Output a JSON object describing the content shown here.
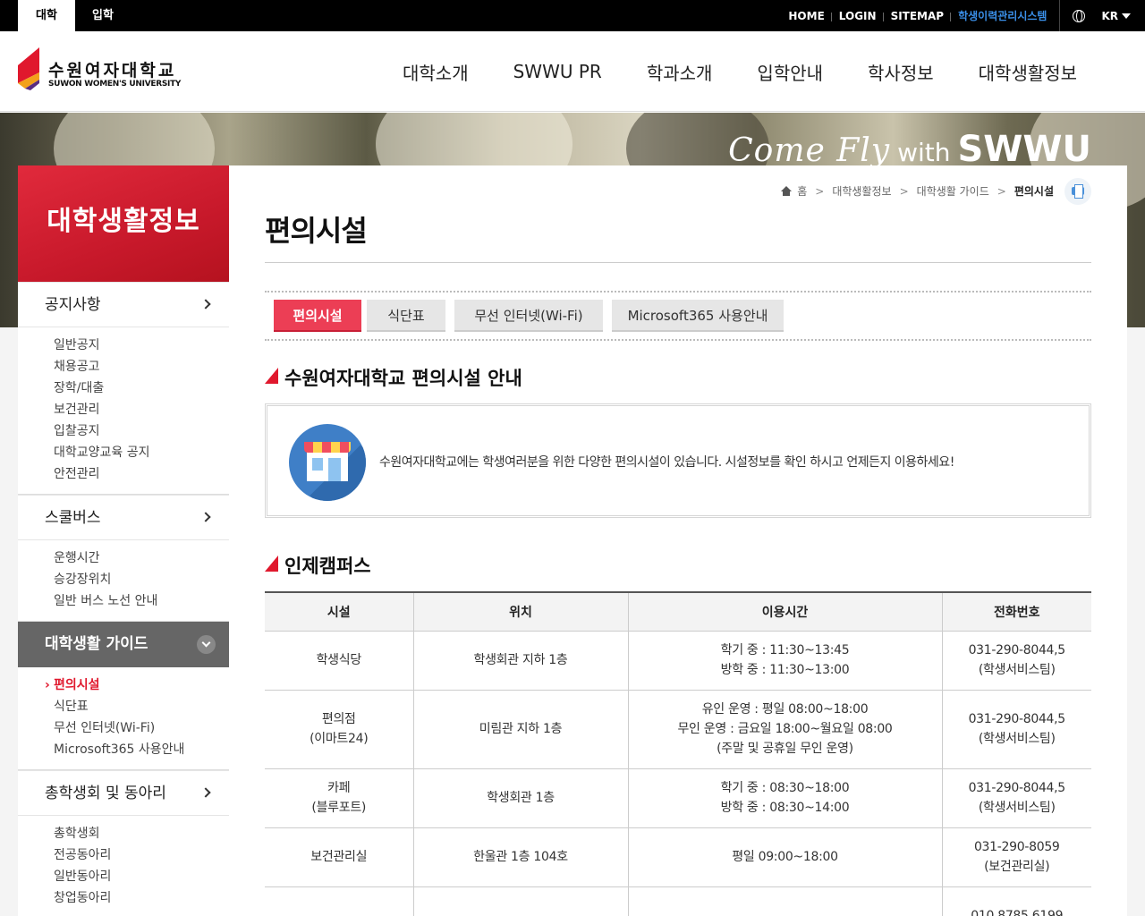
{
  "topbar": {
    "tabs": [
      "대학",
      "입학"
    ],
    "util_links": [
      "HOME",
      "LOGIN",
      "SITEMAP",
      "학생이력관리시스템"
    ],
    "lang": "KR"
  },
  "header": {
    "logo_kr": "수원여자대학교",
    "logo_en": "SUWON WOMEN'S UNIVERSITY",
    "gnb": [
      "대학소개",
      "SWWU PR",
      "학과소개",
      "입학안내",
      "학사정보",
      "대학생활정보"
    ]
  },
  "visual": {
    "slogan_script": "Come Fly",
    "slogan_with": "with",
    "slogan_brand": "SWWU"
  },
  "sidebar": {
    "title": "대학생활정보",
    "groups": [
      {
        "label": "공지사항",
        "items": [
          "일반공지",
          "채용공고",
          "장학/대출",
          "보건관리",
          "입찰공지",
          "대학교양교육 공지",
          "안전관리"
        ]
      },
      {
        "label": "스쿨버스",
        "items": [
          "운행시간",
          "승강장위치",
          "일반 버스 노선 안내"
        ]
      },
      {
        "label": "대학생활 가이드",
        "items": [
          "편의시설",
          "식단표",
          "무선 인터넷(Wi-Fi)",
          "Microsoft365 사용안내"
        ]
      },
      {
        "label": "총학생회 및 동아리",
        "items": [
          "총학생회",
          "전공동아리",
          "일반동아리",
          "창업동아리"
        ]
      }
    ]
  },
  "breadcrumb": [
    "홈",
    "대학생활정보",
    "대학생활 가이드",
    "편의시설"
  ],
  "page_title": "편의시설",
  "tabs": [
    "편의시설",
    "식단표",
    "무선 인터넷(Wi-Fi)",
    "Microsoft365 사용안내"
  ],
  "intro": {
    "heading": "수원여자대학교 편의시설 안내",
    "text": "수원여자대학교에는 학생여러분을 위한 다양한 편의시설이 있습니다. 시설정보를 확인 하시고 언제든지 이용하세요!"
  },
  "campus": {
    "heading": "인제캠퍼스",
    "headers": [
      "시설",
      "위치",
      "이용시간",
      "전화번호"
    ],
    "rows": [
      {
        "facility": [
          "학생식당"
        ],
        "location": [
          "학생회관 지하 1층"
        ],
        "hours": [
          "학기 중 : 11:30~13:45",
          "방학 중 : 11:30~13:00"
        ],
        "phone": [
          "031-290-8044,5",
          "(학생서비스팀)"
        ]
      },
      {
        "facility": [
          "편의점",
          "(이마트24)"
        ],
        "location": [
          "미림관 지하 1층"
        ],
        "hours": [
          "유인 운영 : 평일 08:00~18:00",
          "무인 운영 : 금요일 18:00~월요일 08:00",
          "(주말 및 공휴일 무인 운영)"
        ],
        "phone": [
          "031-290-8044,5",
          "(학생서비스팀)"
        ]
      },
      {
        "facility": [
          "카페",
          "(블루포트)"
        ],
        "location": [
          "학생회관 1층"
        ],
        "hours": [
          "학기 중 : 08:30~18:00",
          "방학 중 : 08:30~14:00"
        ],
        "phone": [
          "031-290-8044,5",
          "(학생서비스팀)"
        ]
      },
      {
        "facility": [
          "보건관리실"
        ],
        "location": [
          "한울관 1층 104호"
        ],
        "hours": [
          "평일 09:00~18:00"
        ],
        "phone": [
          "031-290-8059",
          "(보건관리실)"
        ]
      },
      {
        "facility": [
          ""
        ],
        "location": [
          ""
        ],
        "hours": [
          ""
        ],
        "phone": [
          "010.8785.6199"
        ]
      }
    ]
  },
  "colors": {
    "accent": "#e0182d",
    "tab_active": "#ec3e55",
    "highlight_link": "#3a8fe8"
  }
}
